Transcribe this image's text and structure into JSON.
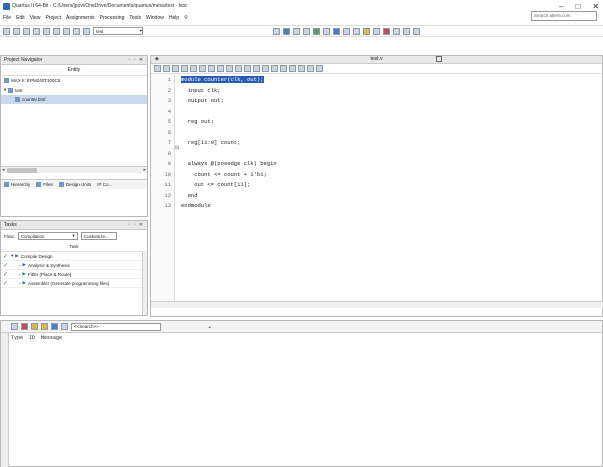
{
  "window": {
    "title": "Quartus II 64-Bit - C:/Users/jpovi/OneDrive/Documents/quartus/mesa/test - test",
    "min": "–",
    "max": "□",
    "close": "✕"
  },
  "menu": [
    "File",
    "Edit",
    "View",
    "Project",
    "Assignments",
    "Processing",
    "Tools",
    "Window",
    "Help"
  ],
  "search": {
    "placeholder": "Search altera.com"
  },
  "toolbar": {
    "project_combo": "test"
  },
  "project_navigator": {
    "title": "Project Navigator",
    "entity_header": "Entity",
    "device": "MAX II: EPM240T100C5",
    "top": "test",
    "child": "counter.bmf",
    "tabs": [
      "Hierarchy",
      "Files",
      "Design Units",
      "IP Co..."
    ]
  },
  "tasks": {
    "title": "Tasks",
    "flow_label": "Flow:",
    "flow_value": "Compilation",
    "customize": "Customize...",
    "column_header": "Task",
    "rows": [
      {
        "label": "Compile Design",
        "indent": 0
      },
      {
        "label": "Analysis & Synthesis",
        "indent": 1
      },
      {
        "label": "Fitter (Place & Route)",
        "indent": 1
      },
      {
        "label": "Assembler (Generate programming files)",
        "indent": 1
      }
    ]
  },
  "editor": {
    "tab_title": "test.v",
    "lines": [
      {
        "n": "1",
        "text": "module counter(clk, out);"
      },
      {
        "n": "2",
        "text": "  input clk;"
      },
      {
        "n": "3",
        "text": "  output out;"
      },
      {
        "n": "4",
        "text": ""
      },
      {
        "n": "5",
        "text": "  reg out;"
      },
      {
        "n": "6",
        "text": ""
      },
      {
        "n": "7",
        "text": "  reg[11:0] count;"
      },
      {
        "n": "8",
        "text": ""
      },
      {
        "n": "9",
        "text": "  always @(posedge clk) begin"
      },
      {
        "n": "10",
        "text": "    count <= count + 1'b1;"
      },
      {
        "n": "11",
        "text": "    out <= count[11];"
      },
      {
        "n": "12",
        "text": "  end"
      },
      {
        "n": "13",
        "text": "endmodule"
      }
    ]
  },
  "messages": {
    "search_placeholder": "<<Search>>",
    "columns": [
      "Type",
      "ID",
      "Message"
    ]
  }
}
